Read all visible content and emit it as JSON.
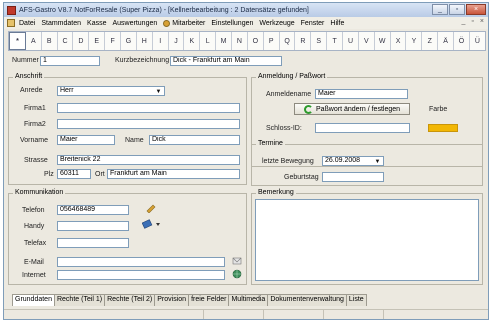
{
  "window": {
    "title": "AFS-Gastro V8.7 NotForResale (Super Pizza) - [Kellnerbearbeitung : 2 Datensätze gefunden]"
  },
  "menu": [
    "Datei",
    "Stammdaten",
    "Kasse",
    "Auswertungen",
    "Mitarbeiter",
    "Einstellungen",
    "Werkzeuge",
    "Fenster",
    "Hilfe"
  ],
  "menu_right": [
    "_",
    "▫",
    "×"
  ],
  "alphabet": [
    "*",
    "A",
    "B",
    "C",
    "D",
    "E",
    "F",
    "G",
    "H",
    "I",
    "J",
    "K",
    "L",
    "M",
    "N",
    "O",
    "P",
    "Q",
    "R",
    "S",
    "T",
    "U",
    "V",
    "W",
    "X",
    "Y",
    "Z",
    "Ä",
    "Ö",
    "Ü"
  ],
  "header": {
    "nummer_label": "Nummer",
    "nummer_value": "1",
    "kurz_label": "Kurzbezeichnung",
    "kurz_value": "Dick - Frankfurt am Main"
  },
  "anschrift": {
    "title": "Anschrift",
    "anrede_label": "Anrede",
    "anrede_value": "Herr",
    "firma1_label": "Firma1",
    "firma1_value": "",
    "firma2_label": "Firma2",
    "firma2_value": "",
    "vorname_label": "Vorname",
    "vorname_value": "Maier",
    "name_label": "Name",
    "name_value": "Dick",
    "strasse_label": "Strasse",
    "strasse_value": "Breitenick 22",
    "plz_label": "Plz",
    "plz_value": "60311",
    "ort_label": "Ort",
    "ort_value": "Frankfurt am Main"
  },
  "anmeldung": {
    "title": "Anmeldung / Paßwort",
    "anmeldename_label": "Anmeldename",
    "anmeldename_value": "Maier",
    "passwort_button": "Paßwort ändern / festlegen",
    "farbe_label": "Farbe",
    "farbe_color": "#f2b705",
    "schloss_label": "Schloss-ID:",
    "schloss_value": ""
  },
  "termine": {
    "title": "Termine",
    "letzte_label": "letzte Bewegung",
    "letzte_value": "26.09.2008",
    "geburtstag_label": "Geburtstag",
    "geburtstag_value": ""
  },
  "kommunikation": {
    "title": "Kommunikation",
    "telefon_label": "Telefon",
    "telefon_value": "056468489",
    "handy_label": "Handy",
    "handy_value": "",
    "telefax_label": "Telefax",
    "telefax_value": "",
    "email_label": "E-Mail",
    "email_value": "",
    "internet_label": "Internet",
    "internet_value": ""
  },
  "bemerkung": {
    "title": "Bemerkung",
    "value": ""
  },
  "tabs": [
    "Grunddaten",
    "Rechte (Teil 1)",
    "Rechte (Teil 2)",
    "Provision",
    "freie Felder",
    "Multimedia",
    "Dokumentenverwaltung",
    "Liste"
  ]
}
